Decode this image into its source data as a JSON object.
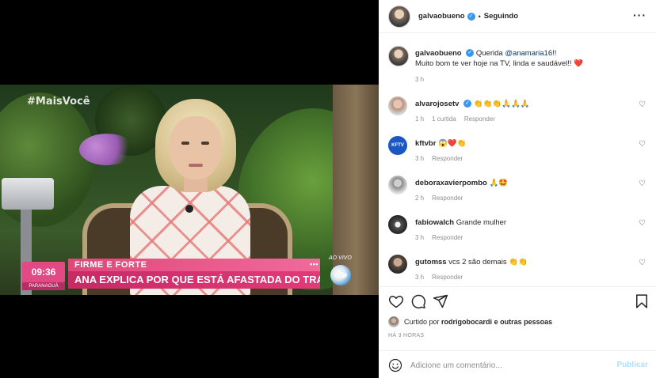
{
  "video": {
    "hashtag": "#MaisVocê",
    "clock_time": "09:36",
    "clock_city": "PARANAGUÁ",
    "live_label": "AO VIVO",
    "lower_third_top": "FIRME E FORTE",
    "lower_third_main": "ANA EXPLICA POR QUE ESTÁ AFASTADA DO TRABALHO"
  },
  "header": {
    "username": "galvaobueno",
    "verified": true,
    "separator": "•",
    "follow_status": "Seguindo",
    "more_icon": "more-horizontal-icon"
  },
  "caption": {
    "username": "galvaobueno",
    "prefix": "Querida ",
    "mention": "@anamaria16",
    "suffix": "!!",
    "line2": "Muito bom te ver hoje na TV, linda e saudável!! ❤️",
    "time": "3 h"
  },
  "comments": [
    {
      "username": "alvarojosetv",
      "verified": true,
      "text": "👏👏👏🙏🙏🙏",
      "time": "1 h",
      "likes": "1 curtida",
      "reply": "Responder"
    },
    {
      "username": "kftvbr",
      "avatar_text": "KFTV",
      "text": "😱❤️👏",
      "time": "3 h",
      "reply": "Responder"
    },
    {
      "username": "deboraxavierpombo",
      "text": "🙏🤩",
      "time": "2 h",
      "reply": "Responder"
    },
    {
      "username": "fabiowalch",
      "text": "Grande mulher",
      "time": "3 h",
      "reply": "Responder"
    },
    {
      "username": "gutomss",
      "text": "vcs 2 são demais 👏👏",
      "time": "3 h",
      "reply": "Responder"
    }
  ],
  "actions": {
    "like_icon": "heart-icon",
    "comment_icon": "comment-icon",
    "share_icon": "send-icon",
    "save_icon": "bookmark-icon"
  },
  "liked_by": {
    "prefix": "Curtido por ",
    "user": "rodrigobocardi",
    "suffix": " e outras pessoas"
  },
  "posted_ago": "HÁ 3 HORAS",
  "composer": {
    "placeholder": "Adicione um comentário...",
    "publish_label": "Publicar",
    "emoji_icon": "smiley-icon"
  },
  "colors": {
    "verified_blue": "#3897f0",
    "heart_red": "#ed4956",
    "publish_disabled": "#b2dffc",
    "mention": "#00376b"
  }
}
